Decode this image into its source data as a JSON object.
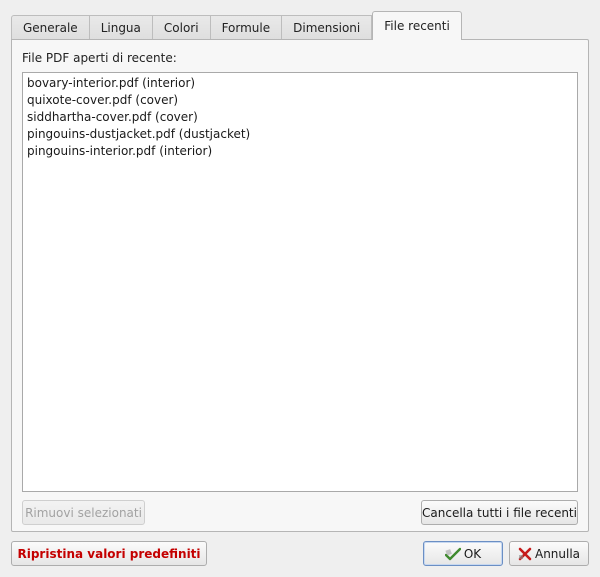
{
  "tabs": [
    {
      "label": "Generale"
    },
    {
      "label": "Lingua"
    },
    {
      "label": "Colori"
    },
    {
      "label": "Formule"
    },
    {
      "label": "Dimensioni"
    },
    {
      "label": "File recenti",
      "active": true
    }
  ],
  "recent": {
    "label": "File PDF aperti di recente:",
    "files": [
      "bovary-interior.pdf (interior)",
      "quixote-cover.pdf (cover)",
      "siddhartha-cover.pdf (cover)",
      "pingouins-dustjacket.pdf (dustjacket)",
      "pingouins-interior.pdf (interior)"
    ],
    "remove_label": "Rimuovi selezionati",
    "clear_all_label": "Cancella tutti i file recenti"
  },
  "footer": {
    "reset_label": "Ripristina valori predefiniti",
    "ok_label": "OK",
    "cancel_label": "Annulla"
  },
  "colors": {
    "reset_text": "#c40000",
    "ok_icon": "#3f8a2e",
    "cancel_icon": "#c61a1a"
  },
  "icons": {
    "ok": "check-icon",
    "cancel": "x-icon"
  }
}
